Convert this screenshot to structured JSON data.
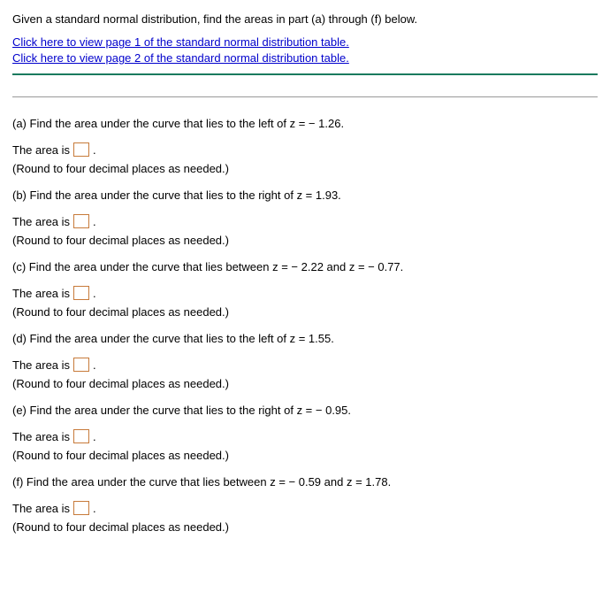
{
  "header": {
    "intro": "Given a standard normal distribution, find the areas in part (a) through (f) below.",
    "link1": "Click here to view page 1 of the standard normal distribution table.",
    "link2": "Click here to view page 2 of the standard normal distribution table."
  },
  "parts": {
    "a": {
      "question": "(a) Find the area under the curve that lies to the left of z = − 1.26.",
      "prefix": "The area is",
      "suffix": ".",
      "hint": "(Round to four decimal places as needed.)"
    },
    "b": {
      "question": "(b) Find the area under the curve that lies to the right of z = 1.93.",
      "prefix": "The area is",
      "suffix": ".",
      "hint": "(Round to four decimal places as needed.)"
    },
    "c": {
      "question": "(c) Find the area under the curve that lies between z = − 2.22 and z = − 0.77.",
      "prefix": "The area is",
      "suffix": ".",
      "hint": "(Round to four decimal places as needed.)"
    },
    "d": {
      "question": "(d) Find the area under the curve that lies to the left of z = 1.55.",
      "prefix": "The area is",
      "suffix": ".",
      "hint": "(Round to four decimal places as needed.)"
    },
    "e": {
      "question": "(e) Find the area under the curve that lies to the right of z = − 0.95.",
      "prefix": "The area is",
      "suffix": ".",
      "hint": "(Round to four decimal places as needed.)"
    },
    "f": {
      "question": "(f) Find the area under the curve that lies between z = − 0.59 and z = 1.78.",
      "prefix": "The area is",
      "suffix": ".",
      "hint": "(Round to four decimal places as needed.)"
    }
  }
}
